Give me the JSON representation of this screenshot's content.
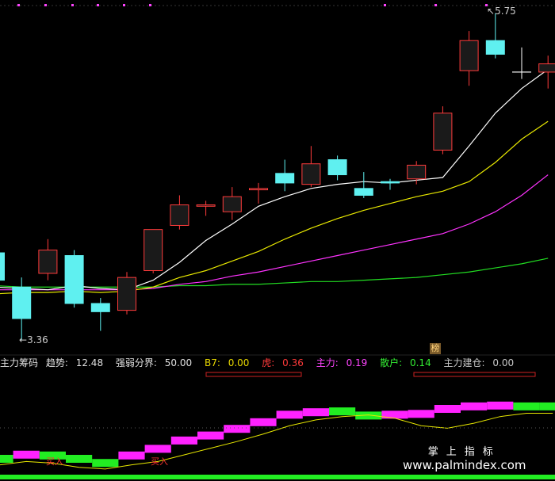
{
  "price_labels": {
    "high": "5.75",
    "low": "3.36"
  },
  "tag_label": "榜",
  "indicator": {
    "title": "主力筹码",
    "items": [
      {
        "label": "趋势:",
        "value": "12.48",
        "color": "#e0e0e0"
      },
      {
        "label": "强弱分界:",
        "value": "50.00",
        "color": "#e0e0e0"
      },
      {
        "label": "B7:",
        "value": "0.00",
        "color": "#e8d800"
      },
      {
        "label": "虎:",
        "value": "0.36",
        "color": "#ff3a3a"
      },
      {
        "label": "主力:",
        "value": "0.19",
        "color": "#ff44ff"
      },
      {
        "label": "散户:",
        "value": "0.14",
        "color": "#33ee33"
      },
      {
        "label": "主力建仓:",
        "value": "0.00",
        "color": "#c8c8c8"
      }
    ]
  },
  "buy_signals": [
    "买入",
    "买入"
  ],
  "watermark": {
    "title": "掌上指标",
    "url": "www.palmindex.com"
  },
  "colors": {
    "up": "#ff3b3b",
    "down": "#5ff0f0",
    "ma5": "#ffffff",
    "ma10": "#e8e800",
    "ma20": "#ff33ff",
    "ma60": "#22dd22"
  },
  "chart_data": {
    "type": "candlestick",
    "candles": [
      {
        "o": 4.0,
        "c": 3.8,
        "h": 4.02,
        "l": 3.73
      },
      {
        "o": 3.75,
        "c": 3.52,
        "h": 3.82,
        "l": 3.36
      },
      {
        "o": 3.85,
        "c": 4.02,
        "h": 4.1,
        "l": 3.8
      },
      {
        "o": 3.98,
        "c": 3.63,
        "h": 4.02,
        "l": 3.6
      },
      {
        "o": 3.63,
        "c": 3.57,
        "h": 3.67,
        "l": 3.43
      },
      {
        "o": 3.58,
        "c": 3.82,
        "h": 3.86,
        "l": 3.55
      },
      {
        "o": 3.87,
        "c": 4.17,
        "h": 4.17,
        "l": 3.85
      },
      {
        "o": 4.2,
        "c": 4.35,
        "h": 4.42,
        "l": 4.17
      },
      {
        "o": 4.34,
        "c": 4.35,
        "h": 4.38,
        "l": 4.27
      },
      {
        "o": 4.3,
        "c": 4.41,
        "h": 4.48,
        "l": 4.24
      },
      {
        "o": 4.46,
        "c": 4.47,
        "h": 4.51,
        "l": 4.36
      },
      {
        "o": 4.58,
        "c": 4.51,
        "h": 4.68,
        "l": 4.45
      },
      {
        "o": 4.5,
        "c": 4.65,
        "h": 4.78,
        "l": 4.48
      },
      {
        "o": 4.68,
        "c": 4.57,
        "h": 4.71,
        "l": 4.53
      },
      {
        "o": 4.47,
        "c": 4.42,
        "h": 4.59,
        "l": 4.4
      },
      {
        "o": 4.52,
        "c": 4.51,
        "h": 4.54,
        "l": 4.46
      },
      {
        "o": 4.54,
        "c": 4.64,
        "h": 4.67,
        "l": 4.5
      },
      {
        "o": 4.75,
        "c": 5.02,
        "h": 5.07,
        "l": 4.72
      },
      {
        "o": 5.33,
        "c": 5.55,
        "h": 5.62,
        "l": 5.22
      },
      {
        "o": 5.55,
        "c": 5.45,
        "h": 5.75,
        "l": 5.42
      },
      {
        "o": 5.32,
        "c": 5.32,
        "h": 5.5,
        "l": 5.27
      },
      {
        "o": 5.32,
        "c": 5.38,
        "h": 5.44,
        "l": 5.2
      }
    ],
    "ma5": [
      3.75,
      3.74,
      3.73,
      3.76,
      3.74,
      3.73,
      3.8,
      3.93,
      4.09,
      4.21,
      4.34,
      4.41,
      4.47,
      4.5,
      4.52,
      4.51,
      4.53,
      4.55,
      4.78,
      5.02,
      5.2,
      5.34
    ],
    "ma10": [
      3.7,
      3.71,
      3.71,
      3.72,
      3.71,
      3.72,
      3.75,
      3.82,
      3.87,
      3.94,
      4.01,
      4.1,
      4.18,
      4.25,
      4.31,
      4.36,
      4.41,
      4.45,
      4.52,
      4.66,
      4.83,
      4.96
    ],
    "ma20": [
      3.73,
      3.73,
      3.73,
      3.73,
      3.73,
      3.73,
      3.74,
      3.77,
      3.79,
      3.83,
      3.86,
      3.9,
      3.94,
      3.98,
      4.02,
      4.06,
      4.1,
      4.14,
      4.21,
      4.3,
      4.42,
      4.57
    ],
    "ma60": [
      3.76,
      3.75,
      3.75,
      3.75,
      3.75,
      3.75,
      3.75,
      3.76,
      3.76,
      3.77,
      3.77,
      3.78,
      3.79,
      3.79,
      3.8,
      3.81,
      3.82,
      3.84,
      3.86,
      3.89,
      3.92,
      3.96
    ],
    "ylim": [
      3.3,
      5.8
    ],
    "steps": [
      {
        "v": 0.2,
        "c": "g"
      },
      {
        "v": 0.25,
        "c": "m"
      },
      {
        "v": 0.24,
        "c": "g"
      },
      {
        "v": 0.2,
        "c": "g"
      },
      {
        "v": 0.15,
        "c": "g"
      },
      {
        "v": 0.24,
        "c": "m"
      },
      {
        "v": 0.32,
        "c": "m"
      },
      {
        "v": 0.42,
        "c": "m"
      },
      {
        "v": 0.48,
        "c": "m"
      },
      {
        "v": 0.56,
        "c": "m"
      },
      {
        "v": 0.64,
        "c": "m"
      },
      {
        "v": 0.73,
        "c": "m"
      },
      {
        "v": 0.76,
        "c": "m"
      },
      {
        "v": 0.77,
        "c": "g"
      },
      {
        "v": 0.72,
        "c": "g"
      },
      {
        "v": 0.73,
        "c": "m"
      },
      {
        "v": 0.74,
        "c": "m"
      },
      {
        "v": 0.8,
        "c": "m"
      },
      {
        "v": 0.83,
        "c": "m"
      },
      {
        "v": 0.84,
        "c": "m"
      },
      {
        "v": 0.83,
        "c": "g"
      },
      {
        "v": 0.83,
        "c": "g"
      }
    ],
    "trend": [
      0.08,
      0.12,
      0.1,
      0.05,
      0.03,
      0.08,
      0.12,
      0.2,
      0.28,
      0.36,
      0.45,
      0.55,
      0.62,
      0.66,
      0.68,
      0.64,
      0.55,
      0.52,
      0.58,
      0.66,
      0.7,
      0.7
    ]
  }
}
